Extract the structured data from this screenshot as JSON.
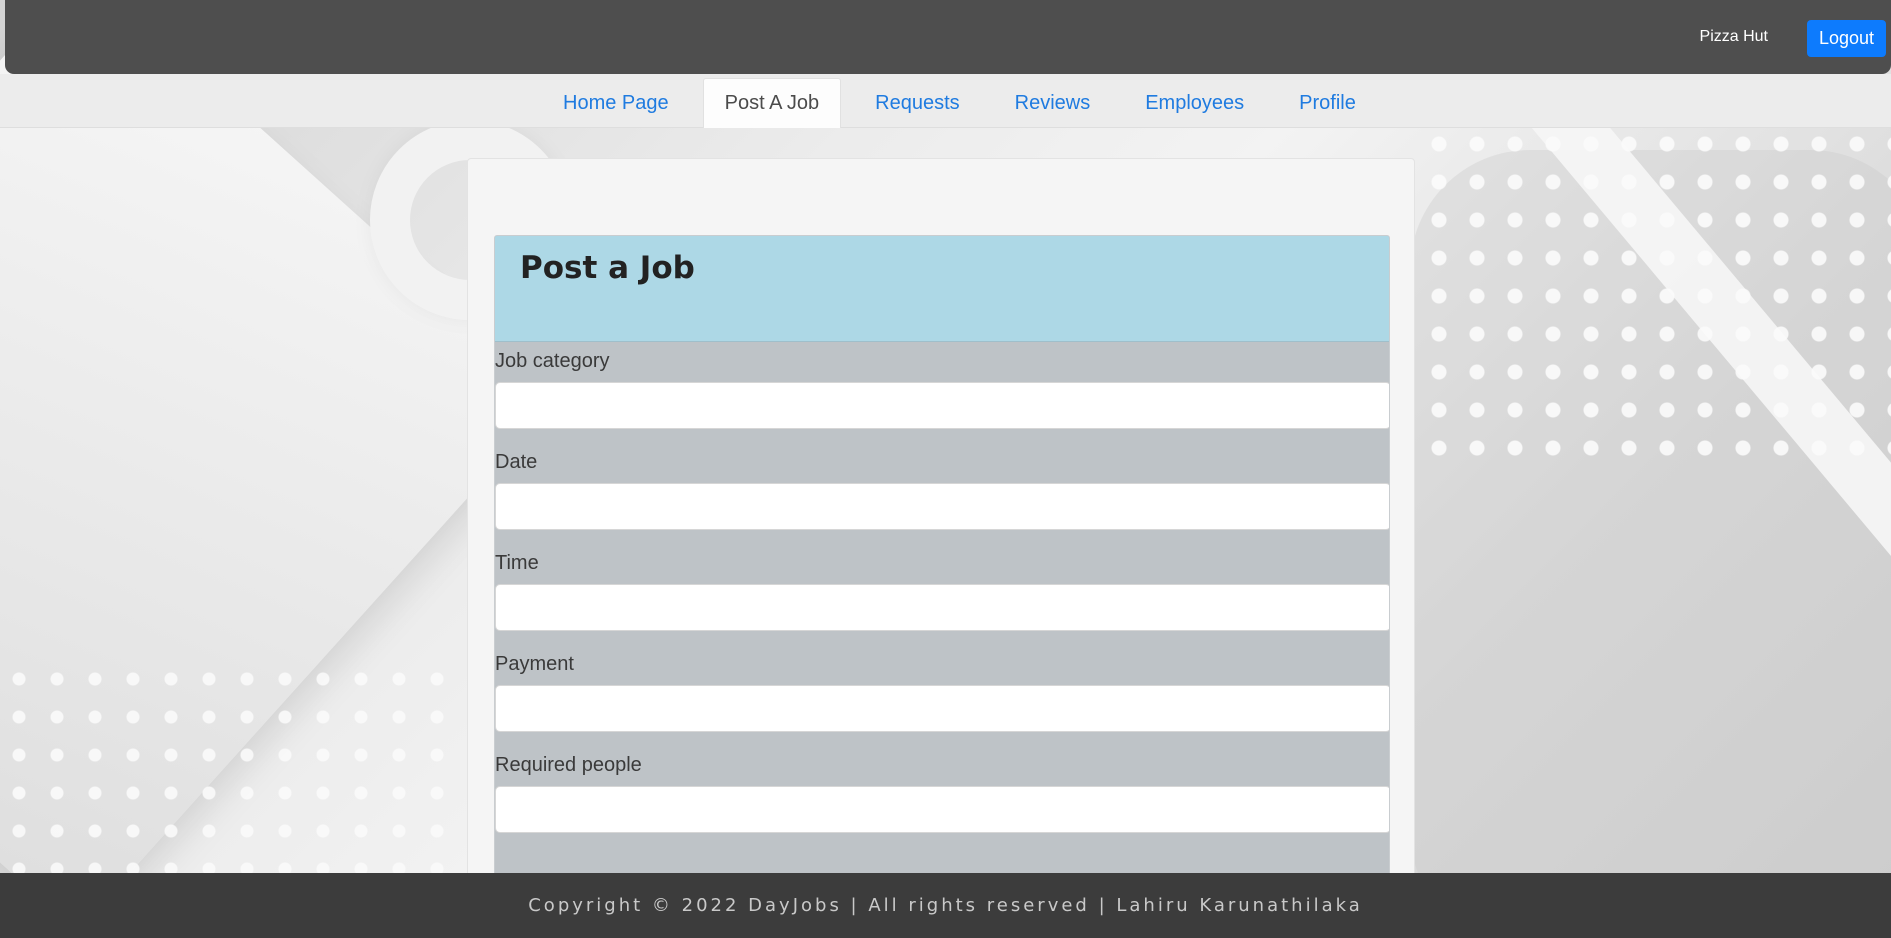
{
  "header": {
    "company_name": "Pizza Hut",
    "logout_label": "Logout",
    "logout_color": "#0d7bfd"
  },
  "tabs": [
    {
      "label": "Home Page",
      "active": false
    },
    {
      "label": "Post A Job",
      "active": true
    },
    {
      "label": "Requests",
      "active": false
    },
    {
      "label": "Reviews",
      "active": false
    },
    {
      "label": "Employees",
      "active": false
    },
    {
      "label": "Profile",
      "active": false
    }
  ],
  "form": {
    "title": "Post a Job",
    "header_color": "#add8e6",
    "fields": [
      {
        "label": "Job category",
        "value": ""
      },
      {
        "label": "Date",
        "value": ""
      },
      {
        "label": "Time",
        "value": ""
      },
      {
        "label": "Payment",
        "value": ""
      },
      {
        "label": "Required people",
        "value": ""
      }
    ]
  },
  "footer": {
    "text": "Copyright © 2022 DayJobs | All rights reserved | Lahiru Karunathilaka"
  }
}
